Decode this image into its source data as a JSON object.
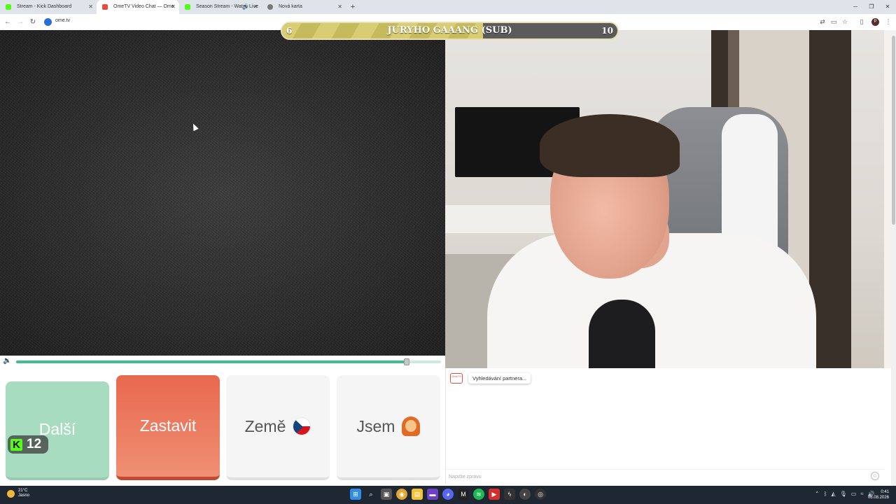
{
  "browser": {
    "tabs": [
      {
        "label": "Stream - Kick Dashboard",
        "favicon_color": "#53fc18",
        "active": false
      },
      {
        "label": "OmeTV Video Chat — Ome",
        "favicon_color": "#e05040",
        "active": true
      },
      {
        "label": "Season Stream - Watch Live",
        "favicon_color": "#53fc18",
        "active": false
      },
      {
        "label": "Nová karta",
        "favicon_color": "#777777",
        "active": false
      }
    ],
    "url": "ome.tv"
  },
  "sub_goal": {
    "title": "JURYHO GAAANG (SUB)",
    "start": "6",
    "end": "10",
    "progress": 0.6
  },
  "volume": {
    "level": 0.92
  },
  "controls": {
    "next_label": "Další",
    "stop_label": "Zastavit",
    "country_label": "Země",
    "gender_label": "Jsem"
  },
  "kick_badge": {
    "count": "12"
  },
  "chat": {
    "logo_text": "OmeTV",
    "status_message": "Vyhledávání partnera...",
    "input_placeholder": "Napište zprávu"
  },
  "taskbar": {
    "weather_temp": "21°C",
    "weather_desc": "Jasno",
    "time": "0:41",
    "date": "06.08.2026"
  },
  "colors": {
    "accent_green": "#3fbf8e",
    "stop_red": "#e8684e",
    "kick_green": "#53fc18"
  }
}
